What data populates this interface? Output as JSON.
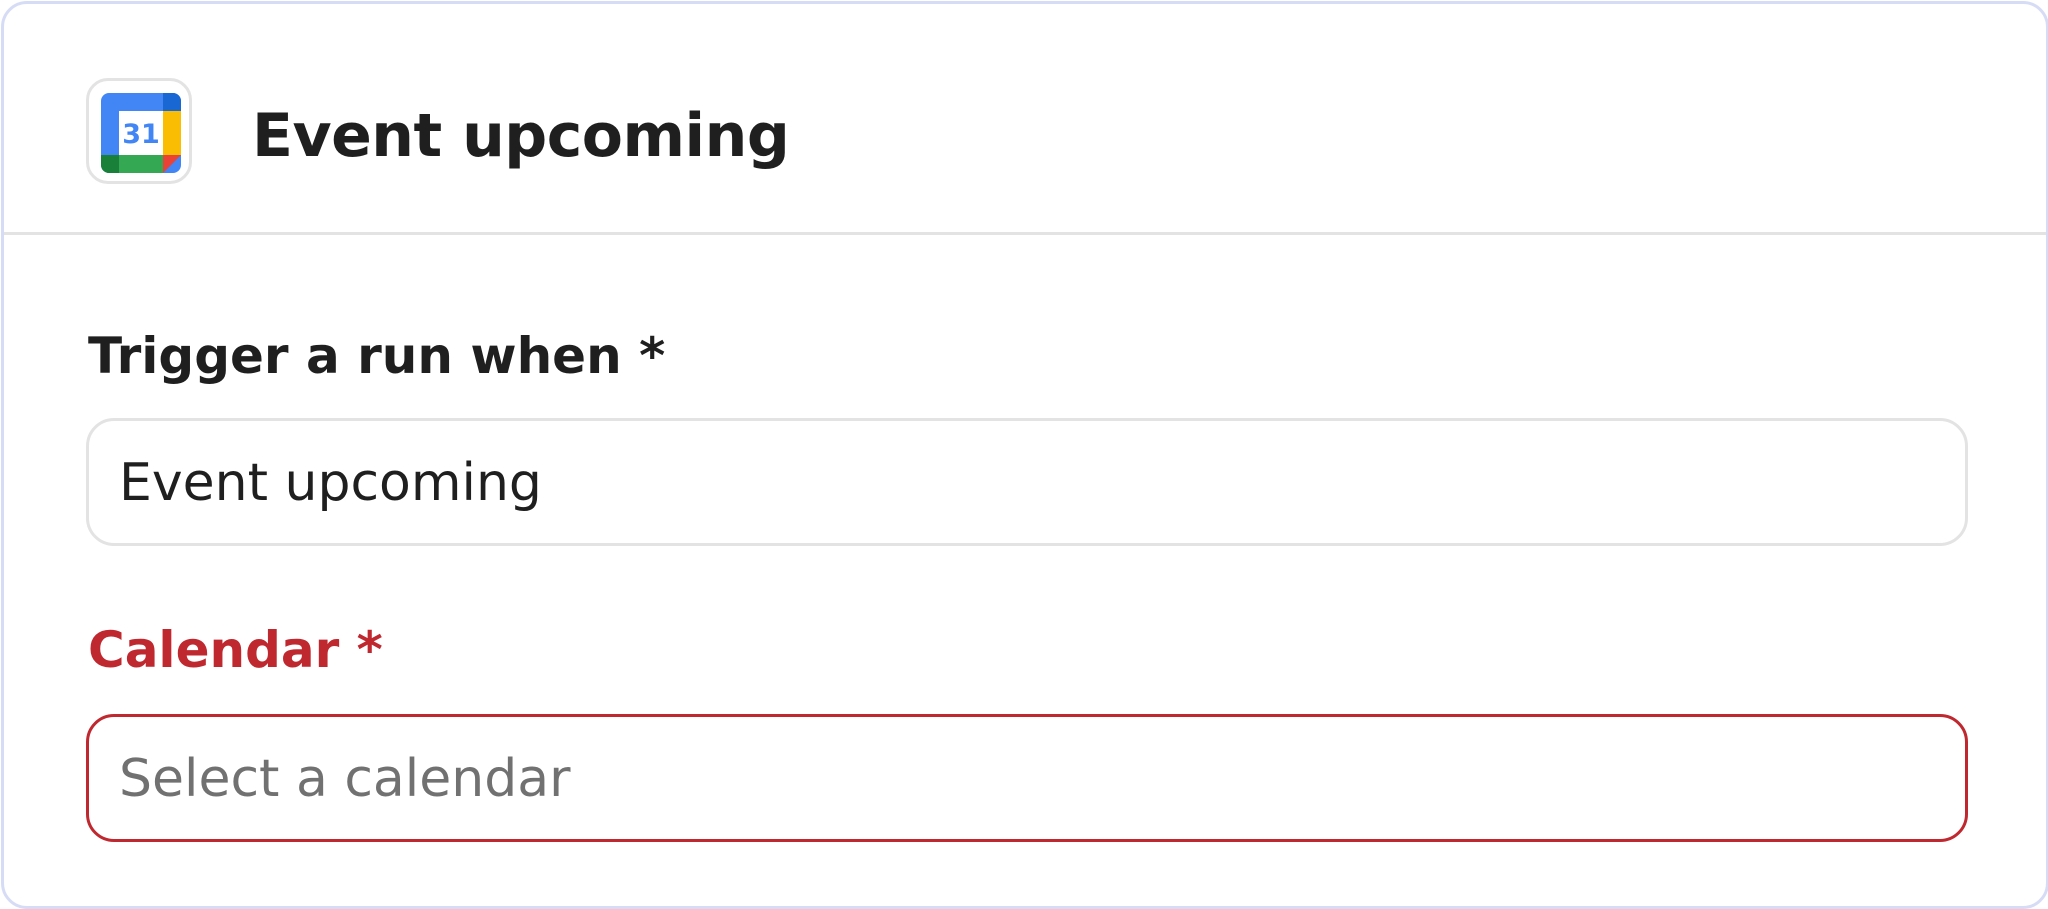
{
  "header": {
    "title": "Event upcoming",
    "app_icon": {
      "name": "google-calendar-icon",
      "day_number": "31",
      "colors": {
        "blue": "#4285f4",
        "dark_blue": "#1967d2",
        "yellow": "#fbbc04",
        "green": "#34a853",
        "dark_green": "#188038",
        "red": "#ea4335"
      }
    }
  },
  "form": {
    "trigger_field": {
      "label": "Trigger a run when *",
      "value": "Event upcoming"
    },
    "calendar_field": {
      "label": "Calendar *",
      "placeholder": "Select a calendar",
      "value": "",
      "state": "error"
    }
  },
  "colors": {
    "panel_border": "#d6dcf5",
    "divider": "#e3e3e3",
    "error": "#c0282f",
    "text": "#1f1f1f",
    "placeholder": "#717171"
  }
}
